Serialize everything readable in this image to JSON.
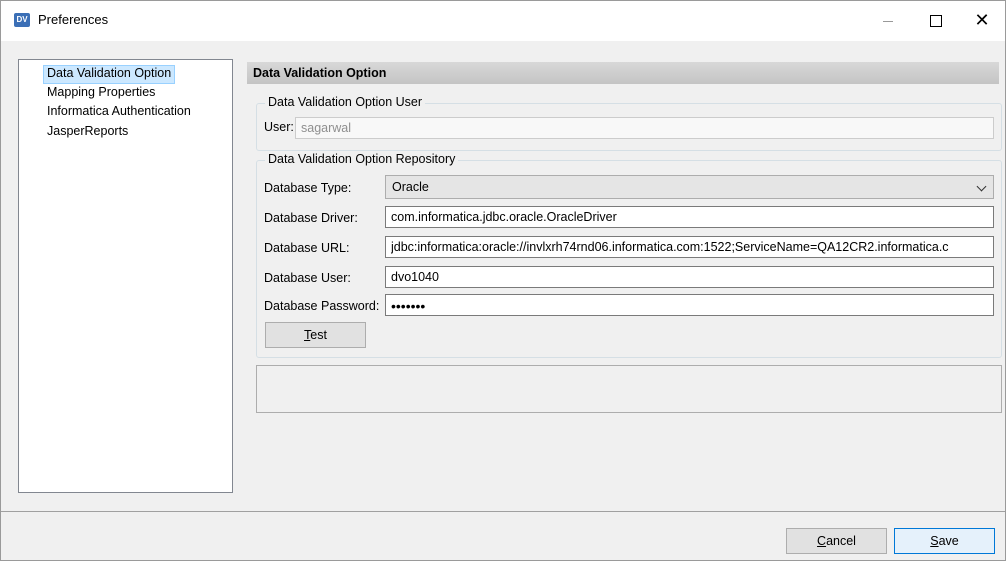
{
  "window": {
    "app_icon_text": "DV",
    "title": "Preferences"
  },
  "nav": {
    "items": [
      {
        "label": "Data Validation Option",
        "selected": true
      },
      {
        "label": "Mapping Properties",
        "selected": false
      },
      {
        "label": "Informatica Authentication",
        "selected": false
      },
      {
        "label": "JasperReports",
        "selected": false
      }
    ]
  },
  "panel": {
    "header": "Data Validation Option",
    "user_group": {
      "legend": "Data Validation Option User",
      "user_label": "User:",
      "user_value": "sagarwal"
    },
    "repo_group": {
      "legend": "Data Validation Option Repository",
      "db_type_label": "Database Type:",
      "db_type_value": "Oracle",
      "db_driver_label": "Database Driver:",
      "db_driver_value": "com.informatica.jdbc.oracle.OracleDriver",
      "db_url_label": "Database URL:",
      "db_url_value": "jdbc:informatica:oracle://invlxrh74rnd06.informatica.com:1522;ServiceName=QA12CR2.informatica.c",
      "db_user_label": "Database User:",
      "db_user_value": "dvo1040",
      "db_password_label": "Database Password:",
      "db_password_mask": "•••••••",
      "test_button_prefix": "",
      "test_button_mnemonic": "T",
      "test_button_rest": "est"
    }
  },
  "footer": {
    "cancel_mnemonic": "C",
    "cancel_rest": "ancel",
    "save_mnemonic": "S",
    "save_rest": "ave"
  },
  "colors": {
    "selection_bg": "#cce8ff",
    "default_button_border": "#0078d7"
  }
}
